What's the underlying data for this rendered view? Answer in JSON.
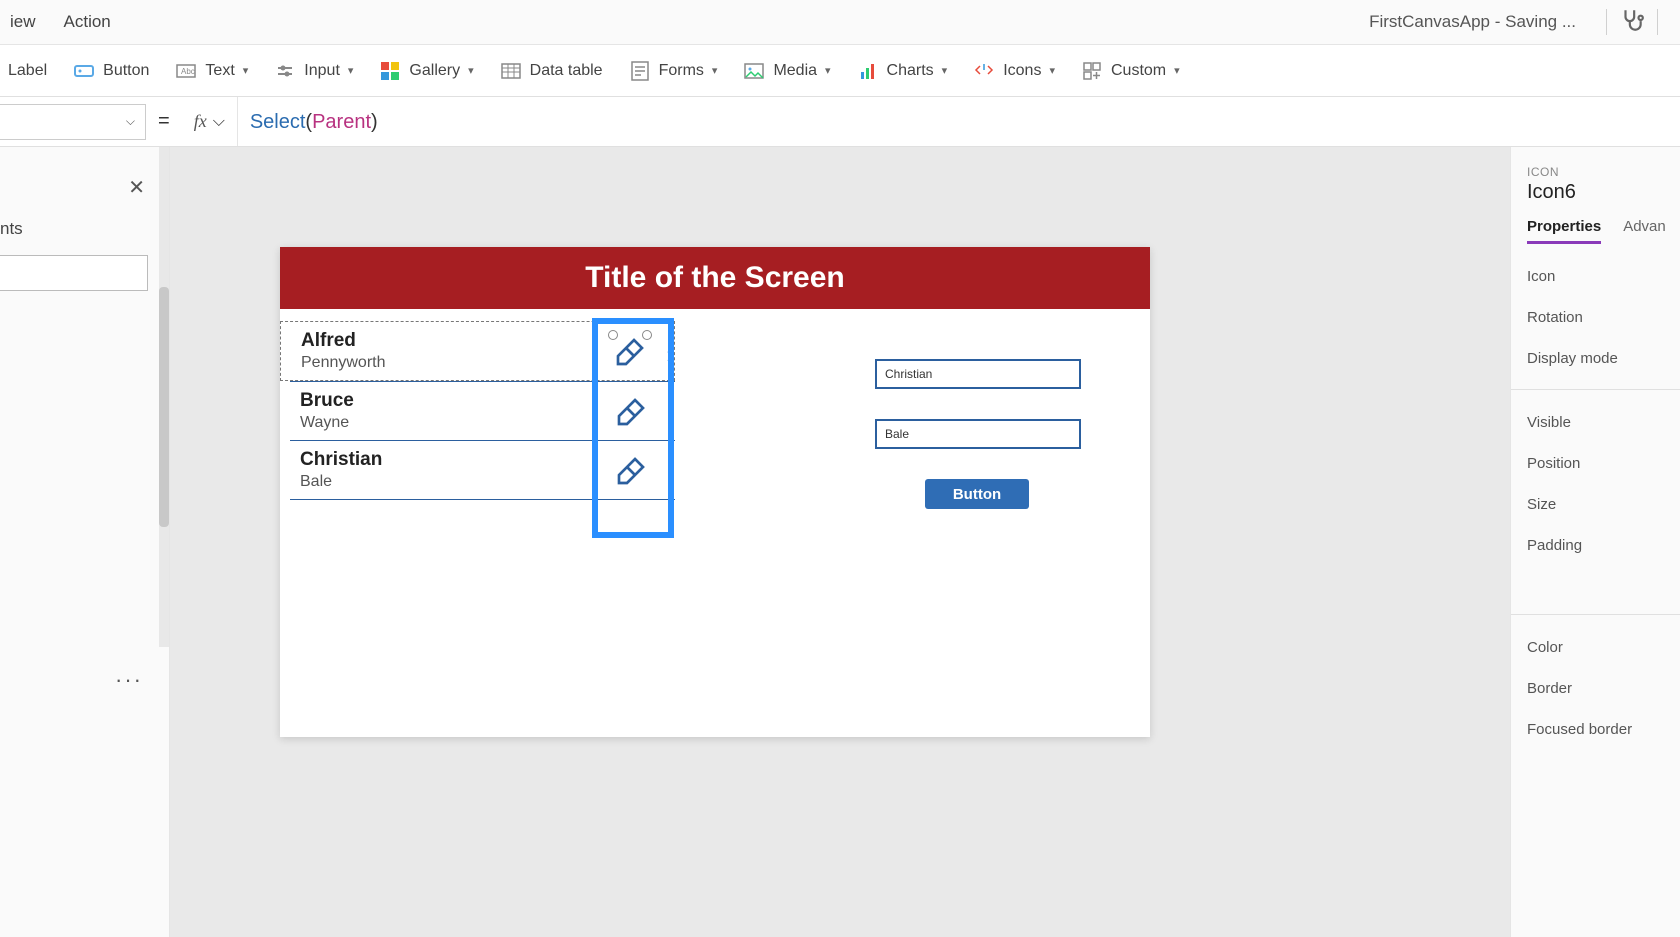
{
  "menubar": {
    "view": "iew",
    "action": "Action",
    "appTitle": "FirstCanvasApp - Saving ..."
  },
  "ribbon": {
    "label": "Label",
    "button": "Button",
    "text": "Text",
    "input": "Input",
    "gallery": "Gallery",
    "datatable": "Data table",
    "forms": "Forms",
    "media": "Media",
    "charts": "Charts",
    "icons": "Icons",
    "custom": "Custom"
  },
  "formula": {
    "func": "Select",
    "arg": "Parent",
    "fxLabel": "fx"
  },
  "left": {
    "title": "nts",
    "formulaSymbol": "="
  },
  "canvas": {
    "title": "Title of the Screen",
    "rows": [
      {
        "first": "Alfred",
        "last": "Pennyworth"
      },
      {
        "first": "Bruce",
        "last": "Wayne"
      },
      {
        "first": "Christian",
        "last": "Bale"
      }
    ],
    "input1": "Christian",
    "input2": "Bale",
    "button": "Button"
  },
  "right": {
    "kicker": "ICON",
    "name": "Icon6",
    "tabs": {
      "properties": "Properties",
      "advanced": "Advan"
    },
    "props": [
      "Icon",
      "Rotation",
      "Display mode",
      "Visible",
      "Position",
      "Size",
      "Padding",
      "Color",
      "Border",
      "Focused border"
    ]
  }
}
